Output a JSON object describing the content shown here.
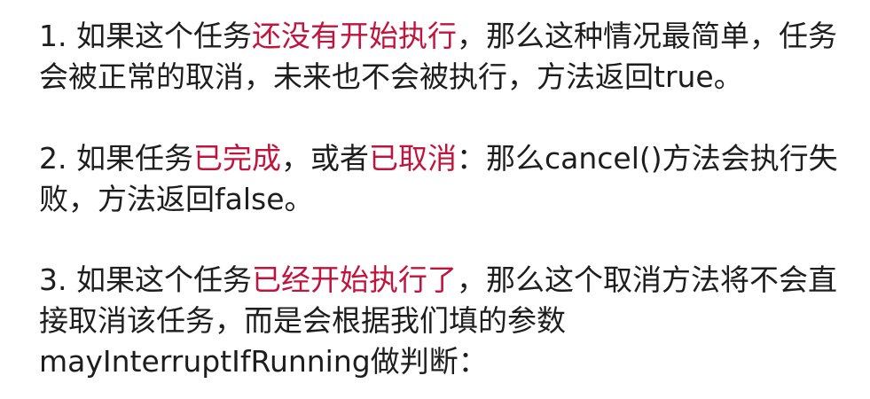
{
  "accent_color": "#c0143c",
  "text_color": "#1d1d1d",
  "paragraphs": [
    {
      "segments": [
        {
          "text": "1. 如果这个任务",
          "highlight": false
        },
        {
          "text": "还没有开始执行",
          "highlight": true
        },
        {
          "text": "，那么这种情况最简单，任务会被正常的取消，未来也不会被执行，方法返回true。",
          "highlight": false
        }
      ]
    },
    {
      "segments": [
        {
          "text": "2. 如果任务",
          "highlight": false
        },
        {
          "text": "已完成",
          "highlight": true
        },
        {
          "text": "，或者",
          "highlight": false
        },
        {
          "text": "已取消",
          "highlight": true
        },
        {
          "text": "：那么cancel()方法会执行失败，方法返回false。",
          "highlight": false
        }
      ]
    },
    {
      "segments": [
        {
          "text": "3. 如果这个任务",
          "highlight": false
        },
        {
          "text": "已经开始执行了",
          "highlight": true
        },
        {
          "text": "，那么这个取消方法将不会直接取消该任务，而是会根据我们填的参数mayInterruptIfRunning做判断：",
          "highlight": false
        }
      ]
    }
  ]
}
